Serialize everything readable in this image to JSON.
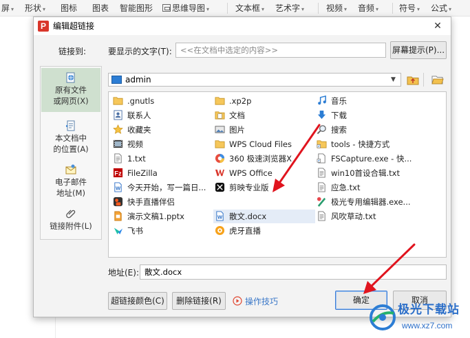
{
  "ribbon": {
    "items": [
      "屏",
      "形状",
      "图标",
      "图表",
      "智能图形",
      "思维导图",
      "文本框",
      "艺术字",
      "视频",
      "音频",
      "符号",
      "公式"
    ]
  },
  "dialog": {
    "title": "编辑超链接",
    "link_to_label": "链接到:",
    "display_text_label": "要显示的文字(T):",
    "display_text_placeholder": "<<在文档中选定的内容>>",
    "screentip_button": "屏幕提示(P)...",
    "sidebar": [
      {
        "line1": "原有文件",
        "line2": "或网页(X)",
        "icon": "globe-file-icon"
      },
      {
        "line1": "本文档中",
        "line2": "的位置(A)",
        "icon": "doc-place-icon"
      },
      {
        "line1": "电子邮件",
        "line2": "地址(M)",
        "icon": "email-icon"
      },
      {
        "line1": "链接附件(L)",
        "line2": "",
        "icon": "paperclip-icon"
      }
    ],
    "folder_path": "admin",
    "files": [
      {
        "name": ".gnutls",
        "icon": "folder"
      },
      {
        "name": "联系人",
        "icon": "contacts"
      },
      {
        "name": "收藏夹",
        "icon": "star"
      },
      {
        "name": "视频",
        "icon": "video"
      },
      {
        "name": "1.txt",
        "icon": "txt"
      },
      {
        "name": "FileZilla",
        "icon": "filezilla"
      },
      {
        "name": "今天开始，写一篇日...",
        "icon": "word"
      },
      {
        "name": "快手直播伴侣",
        "icon": "kuaishou"
      },
      {
        "name": "演示文稿1.pptx",
        "icon": "ppt"
      },
      {
        "name": "飞书",
        "icon": "feishu"
      },
      {
        "name": ".xp2p",
        "icon": "folder"
      },
      {
        "name": "文档",
        "icon": "docs"
      },
      {
        "name": "图片",
        "icon": "picture"
      },
      {
        "name": "WPS Cloud Files",
        "icon": "folder"
      },
      {
        "name": "360 极速浏览器X",
        "icon": "browser360"
      },
      {
        "name": "WPS Office",
        "icon": "wps"
      },
      {
        "name": "剪映专业版",
        "icon": "jianying"
      },
      {
        "name": "散文.docx",
        "icon": "word"
      },
      {
        "name": "虎牙直播",
        "icon": "huya"
      },
      {
        "name": "音乐",
        "icon": "music"
      },
      {
        "name": "下载",
        "icon": "download"
      },
      {
        "name": "搜索",
        "icon": "search"
      },
      {
        "name": "tools - 快捷方式",
        "icon": "shortcut"
      },
      {
        "name": "FSCapture.exe - 快...",
        "icon": "shortcut"
      },
      {
        "name": "win10首设合辑.txt",
        "icon": "txt"
      },
      {
        "name": "应急.txt",
        "icon": "txt"
      },
      {
        "name": "极光专用编辑器.exe...",
        "icon": "editor"
      },
      {
        "name": "风吹草动.txt",
        "icon": "txt"
      }
    ],
    "address_label": "地址(E):",
    "address_value": "散文.docx",
    "hyperlink_color_button": "超链接颜色(C)",
    "remove_link_button": "删除链接(R)",
    "tips_link": "操作技巧",
    "ok_button": "确定",
    "cancel_button": "取消"
  },
  "watermark": {
    "line1": "极光下载站",
    "line2": "www.xz7.com"
  },
  "colors": {
    "accent": "#2c7dd4",
    "arrow": "#e0141e",
    "sidebar_active": "#cfe0cf"
  }
}
